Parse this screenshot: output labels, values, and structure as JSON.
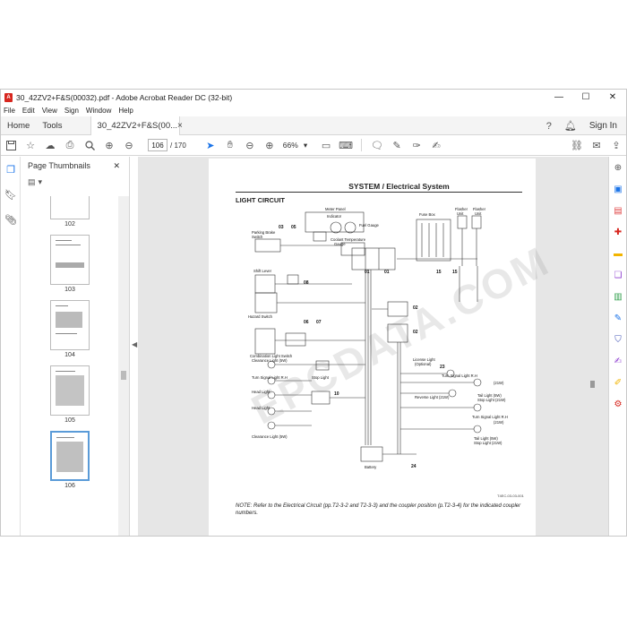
{
  "window": {
    "title": "30_42ZV2+F&S(00032).pdf - Adobe Acrobat Reader DC (32-bit)",
    "app_icon": "acrobat-icon",
    "controls": [
      "—",
      "☐",
      "✕"
    ]
  },
  "menu": [
    "File",
    "Edit",
    "View",
    "Sign",
    "Window",
    "Help"
  ],
  "tabs": {
    "home": "Home",
    "tools": "Tools",
    "document": "30_42ZV2+F&S(00...",
    "close": "×",
    "sign_in": "Sign In"
  },
  "toolbar": {
    "page_current": "106",
    "page_total": "/ 170",
    "zoom": "66%"
  },
  "panel": {
    "title": "Page Thumbnails",
    "close": "✕",
    "thumbnails": [
      {
        "label": "102"
      },
      {
        "label": "103"
      },
      {
        "label": "104"
      },
      {
        "label": "105"
      },
      {
        "label": "106"
      }
    ]
  },
  "document": {
    "heading": "SYSTEM / Electrical System",
    "subheading": "LIGHT CIRCUIT",
    "watermark": "EPCDATA.COM",
    "figure_code": "T4EC-03-03-001",
    "note": "NOTE: Refer to the Electrical Circuit (pp.T2-3-2 and T2-3-3) and the coupler position (p.T2-3-4) for the indicated coupler numbers.",
    "labels": {
      "meter_panel": "Meter Panel",
      "indicator": "Indicator",
      "fuel_gauge": "Fuel Gauge",
      "coolant": "Coolant Temperature",
      "gauge": "Gauge",
      "fuse_box": "Fuse Box",
      "flasher": "Flasher",
      "unit": "Unit",
      "parking_brake": "Parking Brake",
      "switch": "Switch",
      "shift_lever": "Shift Lever",
      "hazard_switch": "Hazard Switch",
      "combination_light_switch": "Combination Light Switch",
      "clearance_light": "Clearance Light (5W)",
      "turn_signal_light_rh": "Turn Signal Light R.H",
      "head_light": "Head Light",
      "stop_light_switch": "Stop Light",
      "battery": "Battery",
      "license_light": "License Light",
      "optional": "(Optional)",
      "turn_signal_rh": "Turn Signal Light R.H",
      "w21": "(21W)",
      "reverse_light": "Reverse Light (21W)",
      "tail_light": "Tail Light (5W)",
      "stop_light": "Stop Light (21W)",
      "n01": "01",
      "n02": "02",
      "n03": "03",
      "n05": "05",
      "n06": "06",
      "n07": "07",
      "n08": "08",
      "n10": "10",
      "n15": "15",
      "n23": "23",
      "n24": "24"
    }
  },
  "icons": {
    "left_rail": [
      "thumbnails-icon",
      "bookmark-icon",
      "attachment-icon"
    ],
    "right_rail_colors": [
      "#555555",
      "#1a73e8",
      "#e04848",
      "#d7261e",
      "#f2b400",
      "#8f3fd0",
      "#2e9d4a",
      "#1a73e8",
      "#3f51b5",
      "#8f3fd0",
      "#f2b400",
      "#d7261e"
    ]
  }
}
